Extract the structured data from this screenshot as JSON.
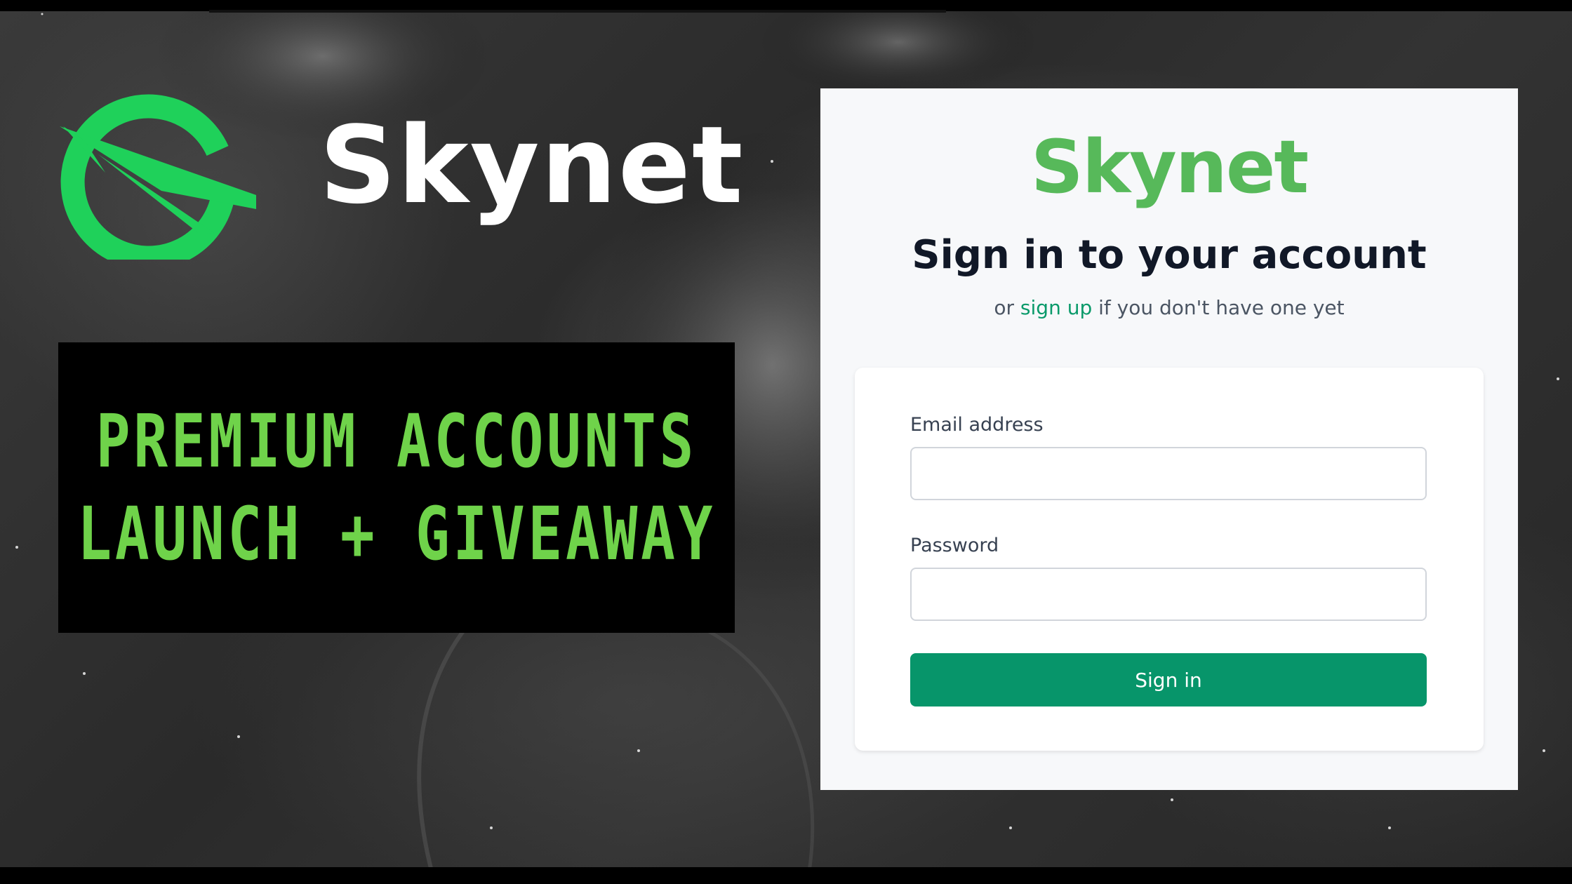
{
  "hero": {
    "brand_name": "Skynet",
    "promo_line_1": "PREMIUM ACCOUNTS",
    "promo_line_2": "LAUNCH + GIVEAWAY"
  },
  "login": {
    "logo_text": "Skynet",
    "heading": "Sign in to your account",
    "subtitle_prefix": "or",
    "signup_link": "sign up",
    "subtitle_suffix": "if you don't have one yet",
    "email_label": "Email address",
    "email_value": "",
    "password_label": "Password",
    "password_value": "",
    "signin_button": "Sign in"
  },
  "colors": {
    "brand_green": "#1fd15a",
    "promo_green": "#6fd34a",
    "logo_text_green": "#57b95a",
    "button_green": "#07956a",
    "link_green": "#0a9a6a"
  },
  "icons": {
    "brand_logo": "skynet-logo-icon"
  }
}
